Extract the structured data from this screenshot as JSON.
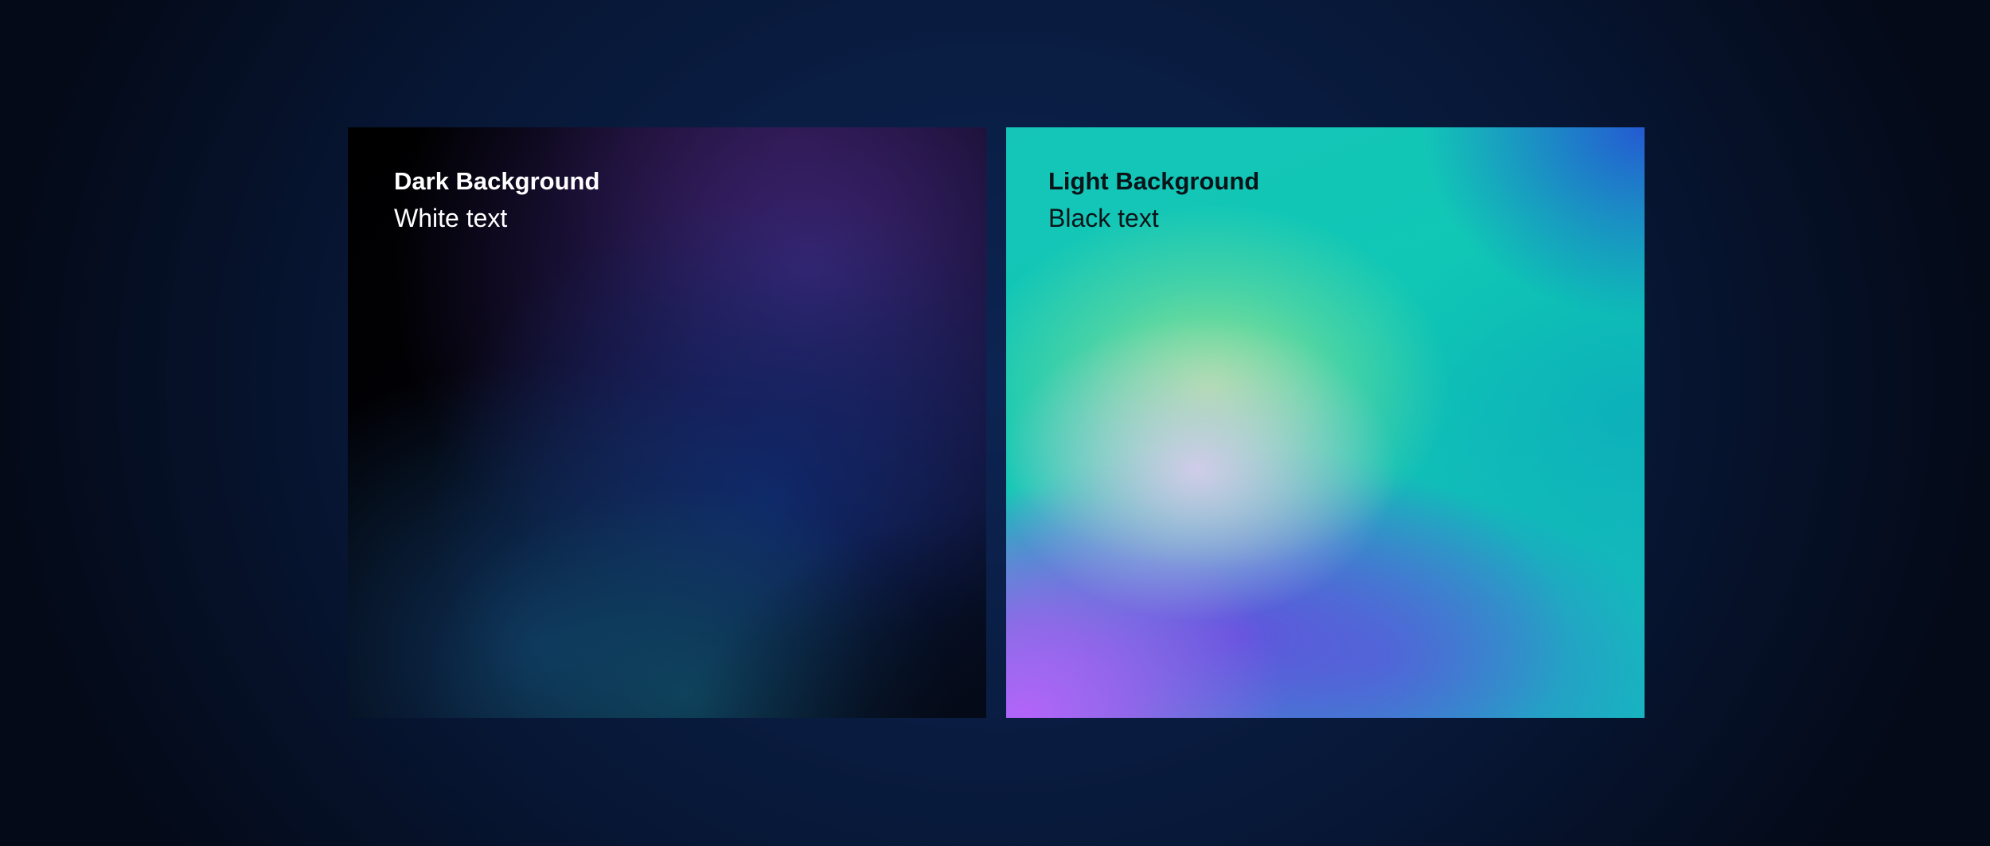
{
  "cards": {
    "dark": {
      "title": "Dark Background",
      "subtitle": "White text",
      "text_color": "#ffffff"
    },
    "light": {
      "title": "Light Background",
      "subtitle": "Black text",
      "text_color": "#0a1418"
    }
  },
  "colors": {
    "page_background": "#0a1e44",
    "dark_card_accent_purple": "#3c2678",
    "dark_card_accent_blue": "#0e2a6e",
    "light_card_accent_teal": "#10c4b6",
    "light_card_accent_green": "#aae88c",
    "light_card_accent_violet": "#b464fa",
    "light_card_accent_blue": "#245ad2"
  }
}
